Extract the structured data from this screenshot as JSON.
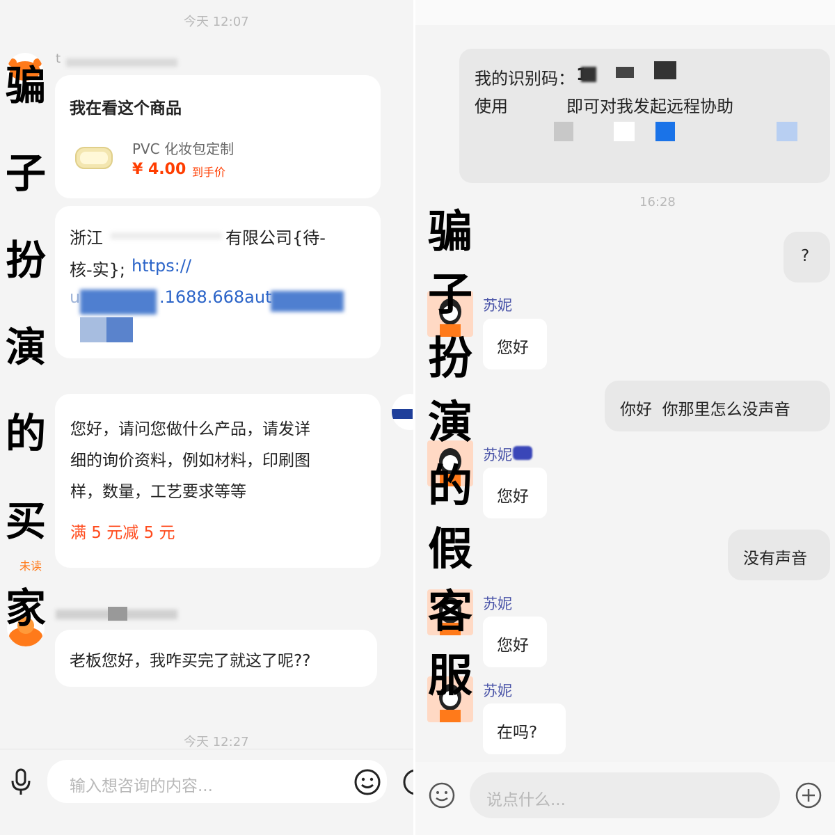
{
  "left": {
    "time_top": "今天 12:07",
    "buyer_name_char": "t",
    "product_card": {
      "title": "我在看这个商品",
      "product_name": "PVC 化妆包定制",
      "price": "¥ 4.00",
      "price_suffix": "到手价"
    },
    "link_message": {
      "line1_a": "浙江",
      "line1_b": "有限公司{待-",
      "line2_a": "核-实};",
      "line2_b": "https://",
      "line3_a": "u",
      "line3_b": ".1688.668aut"
    },
    "reply_message": {
      "line1": "您好，请问您做什么产品，请发详",
      "line2": "细的询价资料，例如材料，印刷图",
      "line3": "样，数量，工艺要求等等",
      "promo": "满 5 元减 5 元"
    },
    "unread_label": "未读",
    "buyer_message": "老板您好，我咋买完了就这了呢??",
    "time_bottom": "今天 12:27",
    "input_placeholder": "输入想咨询的内容...",
    "overlay_chars": [
      "骗",
      "子",
      "扮",
      "演",
      "的",
      "买",
      "家"
    ]
  },
  "right": {
    "remote_card": {
      "line1_label": "我的识别码：",
      "line1_partial": "1",
      "line2_a": "使用",
      "line2_b": "即可对我发起远程协助"
    },
    "time": "16:28",
    "messages": {
      "me_question": "?",
      "agent_name": "苏妮",
      "agent_hello": "您好",
      "me_hello": "你好  你那里怎么没声音",
      "me_no_sound": "没有声音",
      "agent_there": "在吗?"
    },
    "input_placeholder": "说点什么...",
    "overlay_chars": [
      "骗",
      "子",
      "扮",
      "演",
      "的",
      "假",
      "客",
      "服"
    ]
  },
  "colors": {
    "price_red": "#ff3d00",
    "promo_red": "#ff4a1c",
    "link_blue": "#2b64c8",
    "agent_name_blue": "#4a54a8",
    "blur_blue": "#4f7fd0",
    "remote_blue": "#1a73e8"
  },
  "icons": [
    "mic-icon",
    "emoji-icon",
    "plus-icon",
    "product-thumbnail-icon",
    "agent-avatar-icon",
    "buyer-avatar-icon"
  ]
}
